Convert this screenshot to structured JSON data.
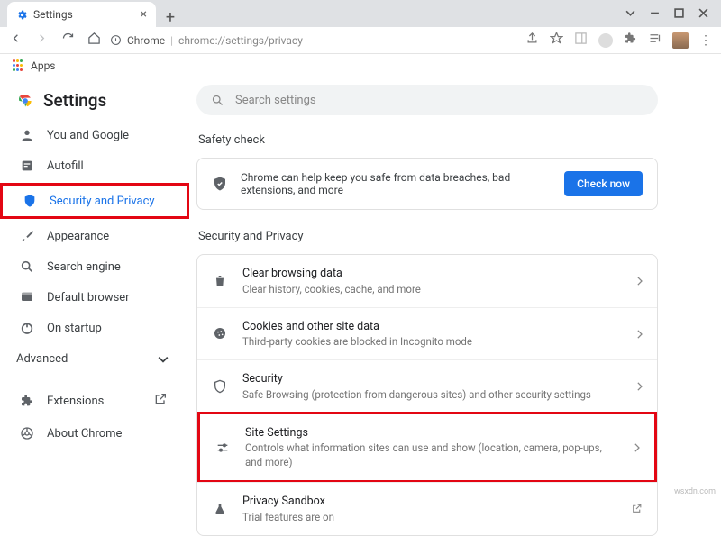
{
  "window": {
    "tab_title": "Settings"
  },
  "urlbar": {
    "chrome_label": "Chrome",
    "url": "chrome://settings/privacy"
  },
  "bookmarks": {
    "apps": "Apps"
  },
  "sidebar": {
    "title": "Settings",
    "items": [
      {
        "label": "You and Google"
      },
      {
        "label": "Autofill"
      },
      {
        "label": "Security and Privacy"
      },
      {
        "label": "Appearance"
      },
      {
        "label": "Search engine"
      },
      {
        "label": "Default browser"
      },
      {
        "label": "On startup"
      }
    ],
    "advanced": "Advanced",
    "extensions": "Extensions",
    "about": "About Chrome"
  },
  "search": {
    "placeholder": "Search settings"
  },
  "safety": {
    "heading": "Safety check",
    "msg": "Chrome can help keep you safe from data breaches, bad extensions, and more",
    "button": "Check now"
  },
  "privacy": {
    "heading": "Security and Privacy",
    "rows": [
      {
        "t1": "Clear browsing data",
        "t2": "Clear history, cookies, cache, and more"
      },
      {
        "t1": "Cookies and other site data",
        "t2": "Third-party cookies are blocked in Incognito mode"
      },
      {
        "t1": "Security",
        "t2": "Safe Browsing (protection from dangerous sites) and other security settings"
      },
      {
        "t1": "Site Settings",
        "t2": "Controls what information sites can use and show (location, camera, pop-ups, and more)"
      },
      {
        "t1": "Privacy Sandbox",
        "t2": "Trial features are on"
      }
    ]
  },
  "footer": "wsxdn.com"
}
